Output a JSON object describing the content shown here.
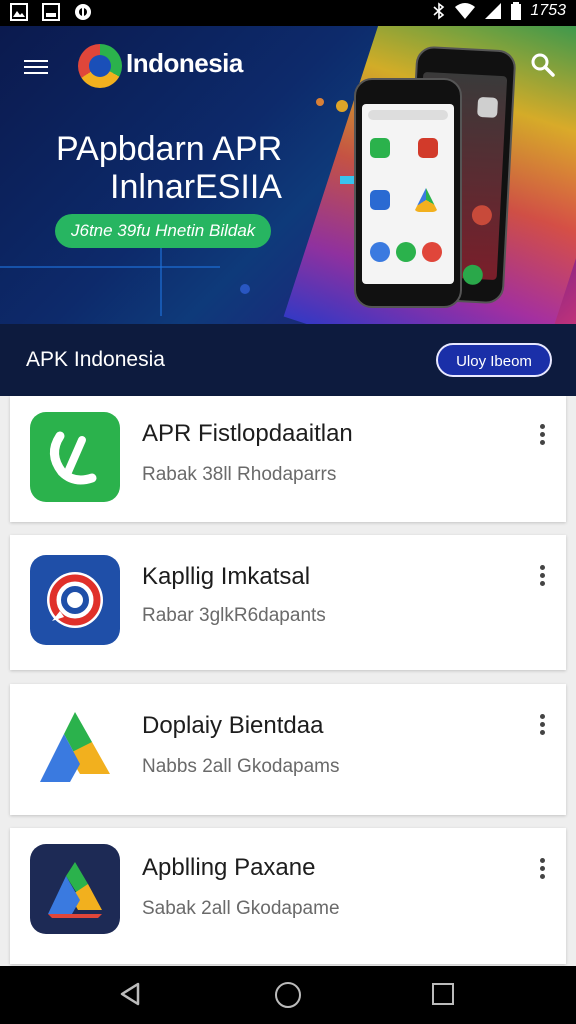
{
  "status_bar": {
    "time": "1753",
    "left_icons": [
      "image-icon",
      "image-icon",
      "notification-icon"
    ],
    "right_icons": [
      "bluetooth-icon",
      "wifi-icon",
      "signal-icon",
      "battery-icon"
    ]
  },
  "header": {
    "brand": "Indonesia",
    "menu_icon": "hamburger-icon",
    "search_icon": "search-icon"
  },
  "hero": {
    "title_line1": "PApbdarn APR",
    "title_line2": "InlnarESIIA",
    "badge": "J6tne 39fu Hnetin Bildak"
  },
  "section_bar": {
    "title": "APK Indonesia",
    "button": "Uloy Ibeom"
  },
  "apps": [
    {
      "name": "APR Fistlopdaaitlan",
      "subtitle": "Rabak 38ll Rhodaparrs",
      "icon": "green-phone-app-icon"
    },
    {
      "name": "Kapllig Imkatsal",
      "subtitle": "Rabar 3glkR6dapants",
      "icon": "red-blue-target-app-icon"
    },
    {
      "name": "Doplaiy Bientdaa",
      "subtitle": "Nabbs 2all Gkodapams",
      "icon": "drive-triangle-app-icon"
    },
    {
      "name": "Apblling Paxane",
      "subtitle": "Sabak 2all Gkodapame",
      "icon": "drive-triangle-dark-app-icon"
    }
  ],
  "nav_bar": {
    "back": "back-icon",
    "home": "home-icon",
    "recent": "recent-apps-icon"
  },
  "colors": {
    "hero_bg": "#0d2a6b",
    "bar_bg": "#0d1b3e",
    "button_bg": "#1a2fa8",
    "badge_bg": "#27b561"
  }
}
